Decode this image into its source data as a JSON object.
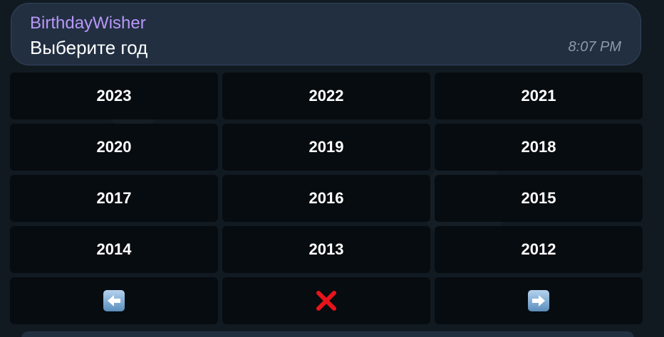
{
  "message": {
    "sender": "BirthdayWisher",
    "text": "Выберите год",
    "time": "8:07 PM"
  },
  "keyboard": {
    "years": [
      "2023",
      "2022",
      "2021",
      "2020",
      "2019",
      "2018",
      "2017",
      "2016",
      "2015",
      "2014",
      "2013",
      "2012"
    ],
    "nav": {
      "prev_icon": "left-arrow-icon",
      "cancel_icon": "cross-mark-icon",
      "next_icon": "right-arrow-icon"
    }
  },
  "colors": {
    "sender_name": "#b997f8",
    "bubble_bg": "#212f41",
    "key_bg": "#060a0e",
    "cancel_red": "#e8141b",
    "arrow_blue": "#5a8ebc"
  }
}
